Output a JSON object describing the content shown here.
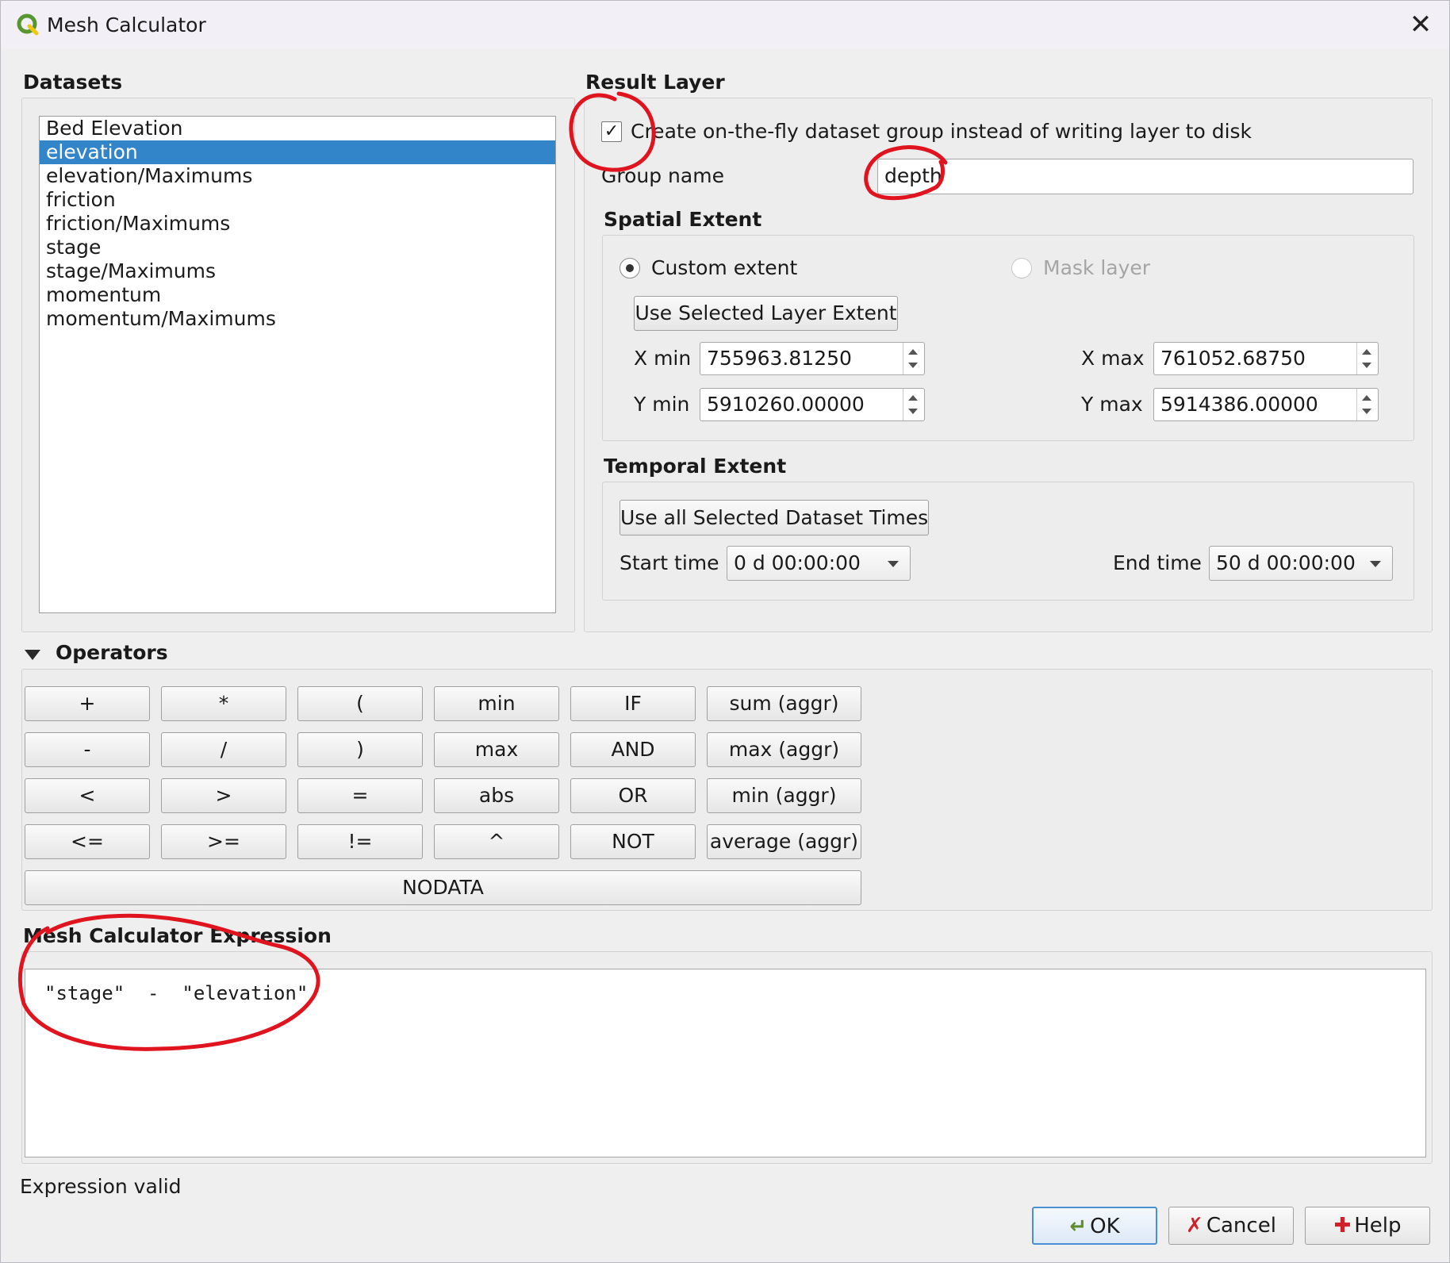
{
  "window": {
    "title": "Mesh Calculator"
  },
  "datasets": {
    "title": "Datasets",
    "items": [
      "Bed Elevation",
      "elevation",
      "elevation/Maximums",
      "friction",
      "friction/Maximums",
      "stage",
      "stage/Maximums",
      "momentum",
      "momentum/Maximums"
    ],
    "selected_index": 1
  },
  "result_layer": {
    "title": "Result Layer",
    "on_the_fly_label": "Create on-the-fly dataset group instead of writing layer to disk",
    "on_the_fly_checked": true,
    "check_glyph": "✓",
    "group_name_label": "Group name",
    "group_name_value": "depth"
  },
  "spatial_extent": {
    "title": "Spatial Extent",
    "custom_extent_label": "Custom extent",
    "mask_layer_label": "Mask layer",
    "use_selected_label": "Use Selected Layer Extent",
    "xmin_label": "X min",
    "xmin_value": "755963.81250",
    "xmax_label": "X max",
    "xmax_value": "761052.68750",
    "ymin_label": "Y min",
    "ymin_value": "5910260.00000",
    "ymax_label": "Y max",
    "ymax_value": "5914386.00000"
  },
  "temporal_extent": {
    "title": "Temporal Extent",
    "use_all_label": "Use all Selected Dataset Times",
    "start_label": "Start time",
    "start_value": "0 d 00:00:00",
    "end_label": "End time",
    "end_value": "50 d 00:00:00"
  },
  "operators": {
    "title": "Operators",
    "rows": [
      [
        "+",
        "*",
        "(",
        "min",
        "IF",
        "sum (aggr)"
      ],
      [
        "-",
        "/",
        ")",
        "max",
        "AND",
        "max (aggr)"
      ],
      [
        "<",
        ">",
        "=",
        "abs",
        "OR",
        "min (aggr)"
      ],
      [
        "<=",
        ">=",
        "!=",
        "^",
        "NOT",
        "average (aggr)"
      ]
    ],
    "nodata_label": "NODATA"
  },
  "expression": {
    "title": "Mesh Calculator Expression",
    "value": "\"stage\"  -  \"elevation\"",
    "status": "Expression valid"
  },
  "buttons": {
    "ok": "OK",
    "cancel": "Cancel",
    "help": "Help"
  },
  "colors": {
    "selection": "#3285c8",
    "annotation": "#e0141e",
    "qgis_green": "#589632",
    "qgis_yellow": "#eec90d"
  },
  "icons": {
    "app": "qgis-logo-icon",
    "close": "close-icon",
    "ok": "ok-arrow-icon",
    "cancel": "cancel-x-icon",
    "help": "help-icon",
    "collapse": "triangle-down-icon"
  }
}
